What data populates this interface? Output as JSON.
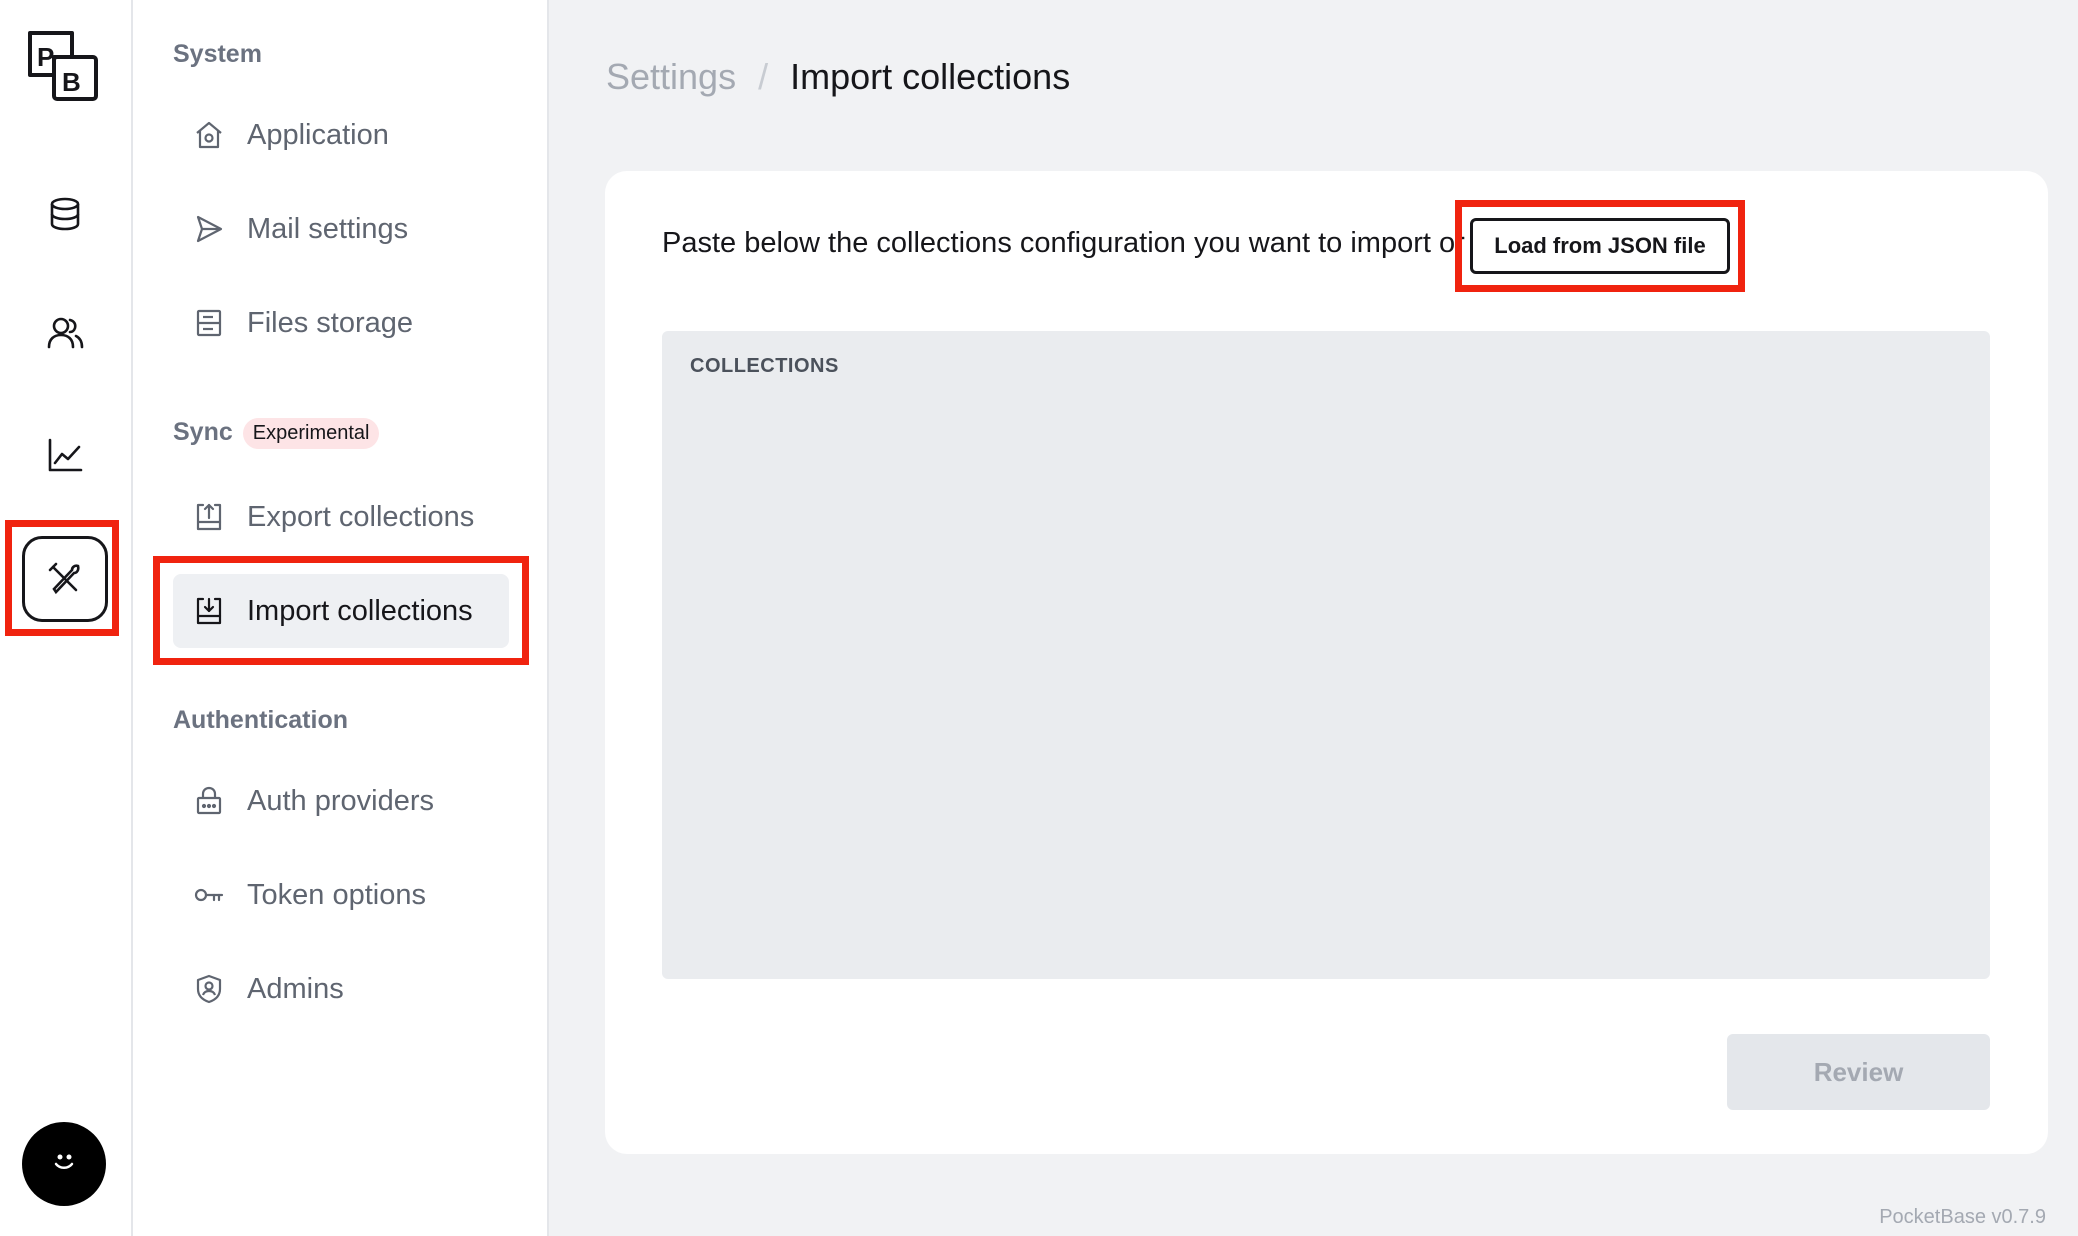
{
  "rail": {
    "logo_top": "P",
    "logo_bottom": "B",
    "items": [
      {
        "icon": "database-icon"
      },
      {
        "icon": "users-icon"
      },
      {
        "icon": "chart-icon"
      },
      {
        "icon": "tools-icon",
        "active": true
      }
    ]
  },
  "sidebar": {
    "system_heading": "System",
    "system_items": [
      {
        "label": "Application",
        "icon": "home-gear-icon"
      },
      {
        "label": "Mail settings",
        "icon": "send-icon"
      },
      {
        "label": "Files storage",
        "icon": "storage-icon"
      }
    ],
    "sync_heading": "Sync",
    "sync_badge": "Experimental",
    "sync_items": [
      {
        "label": "Export collections",
        "icon": "upload-icon"
      },
      {
        "label": "Import collections",
        "icon": "download-icon",
        "active": true
      }
    ],
    "auth_heading": "Authentication",
    "auth_items": [
      {
        "label": "Auth providers",
        "icon": "lock-icon"
      },
      {
        "label": "Token options",
        "icon": "key-icon"
      },
      {
        "label": "Admins",
        "icon": "shield-user-icon"
      }
    ]
  },
  "breadcrumb": {
    "parent": "Settings",
    "separator": "/",
    "current": "Import collections"
  },
  "panel": {
    "intro_text": "Paste below the collections configuration you want to import or",
    "load_button": "Load from JSON file",
    "field_label": "COLLECTIONS",
    "field_value": "",
    "review_button": "Review"
  },
  "footer": {
    "version": "PocketBase v0.7.9"
  },
  "colors": {
    "highlight": "#f0230f",
    "badge_bg": "#fde4e6",
    "active_item_bg": "#eef0f3"
  }
}
